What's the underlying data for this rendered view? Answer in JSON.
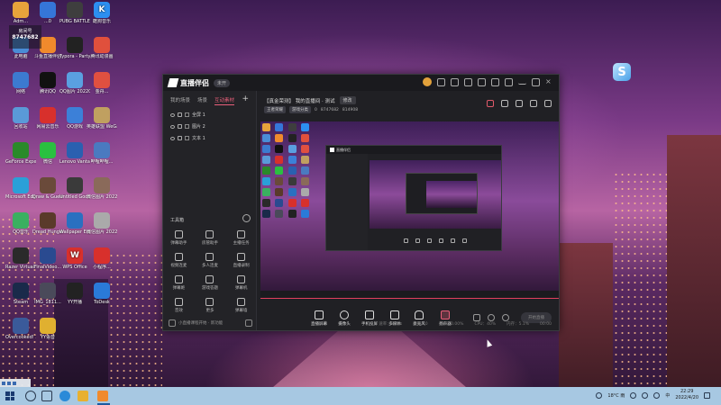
{
  "desktop": {
    "room_overlay": {
      "label": "房间号",
      "value": "8747682"
    },
    "icons": [
      {
        "label": "Adm...",
        "color": "#e7a33b"
      },
      {
        "label": "...0",
        "color": "#3576d8"
      },
      {
        "label": "PUBG BATTLEGR...",
        "color": "#3e3e3e"
      },
      {
        "label": "酷狗音乐",
        "color": "#2c8ff0",
        "glyph": "K"
      },
      {
        "label": "此电脑",
        "color": "#4a8cd6"
      },
      {
        "label": "斗鱼直播伴侣",
        "color": "#f08a2c"
      },
      {
        "label": "Typora - Party",
        "color": "#222"
      },
      {
        "label": "腾讯动漫画",
        "color": "#e0503c"
      },
      {
        "label": "网络",
        "color": "#3c7ad0"
      },
      {
        "label": "腾讯QQ",
        "color": "#111"
      },
      {
        "label": "QQ图片 20220...",
        "color": "#5aa0e0"
      },
      {
        "label": "金舟...",
        "color": "#e05040"
      },
      {
        "label": "回收站",
        "color": "#5a9ad8"
      },
      {
        "label": "网易云音乐",
        "color": "#d8302c"
      },
      {
        "label": "QQ游戏",
        "color": "#3c80d8"
      },
      {
        "label": "英雄联盟 WeGame...",
        "color": "#c0a060"
      },
      {
        "label": "GeForce Experience",
        "color": "#2a8a2a"
      },
      {
        "label": "微信",
        "color": "#2ac040"
      },
      {
        "label": "Lenovo Vantage",
        "color": "#2a60b0"
      },
      {
        "label": "哔哩哔哩...",
        "color": "#4a7ac0"
      },
      {
        "label": "Microsoft Edge",
        "color": "#2aa0d8"
      },
      {
        "label": "Draw & Guess",
        "color": "#6a4a3a"
      },
      {
        "label": "Untitled Goose...",
        "color": "#3a3a3a"
      },
      {
        "label": "微信图片 2022...",
        "color": "#8a6a5a"
      },
      {
        "label": "QQ音乐",
        "color": "#3ab060"
      },
      {
        "label": "Dread Hunger",
        "color": "#5a3a2a"
      },
      {
        "label": "Wallpaper Engine...",
        "color": "#2a70c0"
      },
      {
        "label": "微信图片 2022...",
        "color": "#aaa"
      },
      {
        "label": "Razer Virtual...",
        "color": "#2a2a2a"
      },
      {
        "label": "FinalVideo...",
        "color": "#2a4a90"
      },
      {
        "label": "WPS Office",
        "color": "#d8302c",
        "glyph": "W"
      },
      {
        "label": "小程序...",
        "color": "#d8302c"
      },
      {
        "label": "Steam",
        "color": "#1a2a4a"
      },
      {
        "label": "IMG_1811...",
        "color": "#4a4a5a"
      },
      {
        "label": "YY开播",
        "color": "#222"
      },
      {
        "label": "ToDesk",
        "color": "#2a7ad8"
      },
      {
        "label": "Overcooked! 2",
        "color": "#3a5a9a"
      },
      {
        "label": "YY语音",
        "color": "#e0b030"
      }
    ]
  },
  "app": {
    "name": "直播伴侣",
    "status_badge": "未开",
    "tabs": [
      {
        "label": "我的场景"
      },
      {
        "label": "场景"
      },
      {
        "label": "互动素材"
      }
    ],
    "scene_items": [
      {
        "label": "全屏 1"
      },
      {
        "label": "图片 2"
      },
      {
        "label": "文本 1"
      }
    ],
    "room": {
      "title": "【真金荣测】 我的直播间 · 测试",
      "edit_label": "修改",
      "category": "王者荣耀",
      "sub": "游戏分类",
      "viewers": "8747682",
      "fans": "0",
      "likes": "814908"
    },
    "toolbox_title": "工具箱",
    "tools": [
      {
        "label": "弹幕助手"
      },
      {
        "label": "房管助手"
      },
      {
        "label": "主播任务"
      },
      {
        "label": "视频连麦"
      },
      {
        "label": "多人连麦"
      },
      {
        "label": "直播录制"
      },
      {
        "label": "弹幕姬"
      },
      {
        "label": "游戏答题"
      },
      {
        "label": "弹幕机"
      },
      {
        "label": "音效"
      },
      {
        "label": "更多"
      },
      {
        "label": "弹幕墙"
      }
    ],
    "sidebar_footer": "小直播课程开始 · 新功能",
    "controls": [
      {
        "label": "直播屏幕"
      },
      {
        "label": "摄像头"
      },
      {
        "label": "手机投屏"
      },
      {
        "label": "多媒体"
      },
      {
        "label": "麦克风"
      },
      {
        "label": "扬声器"
      }
    ],
    "go_live_label": "开始直播",
    "status_bar": [
      {
        "label": "速率：0Kb/s"
      },
      {
        "label": "码率：0"
      },
      {
        "label": "丢帧：0.00%"
      },
      {
        "label": "CPU：40%"
      },
      {
        "label": "内存：5.1%"
      },
      {
        "label": "00:00"
      }
    ]
  },
  "taskbar": {
    "weather": "18°C 雨",
    "time": "22:29",
    "date": "2022/4/20"
  },
  "colors": {
    "accent": "#e95f7a",
    "taskbar": "#a7c8e2"
  }
}
